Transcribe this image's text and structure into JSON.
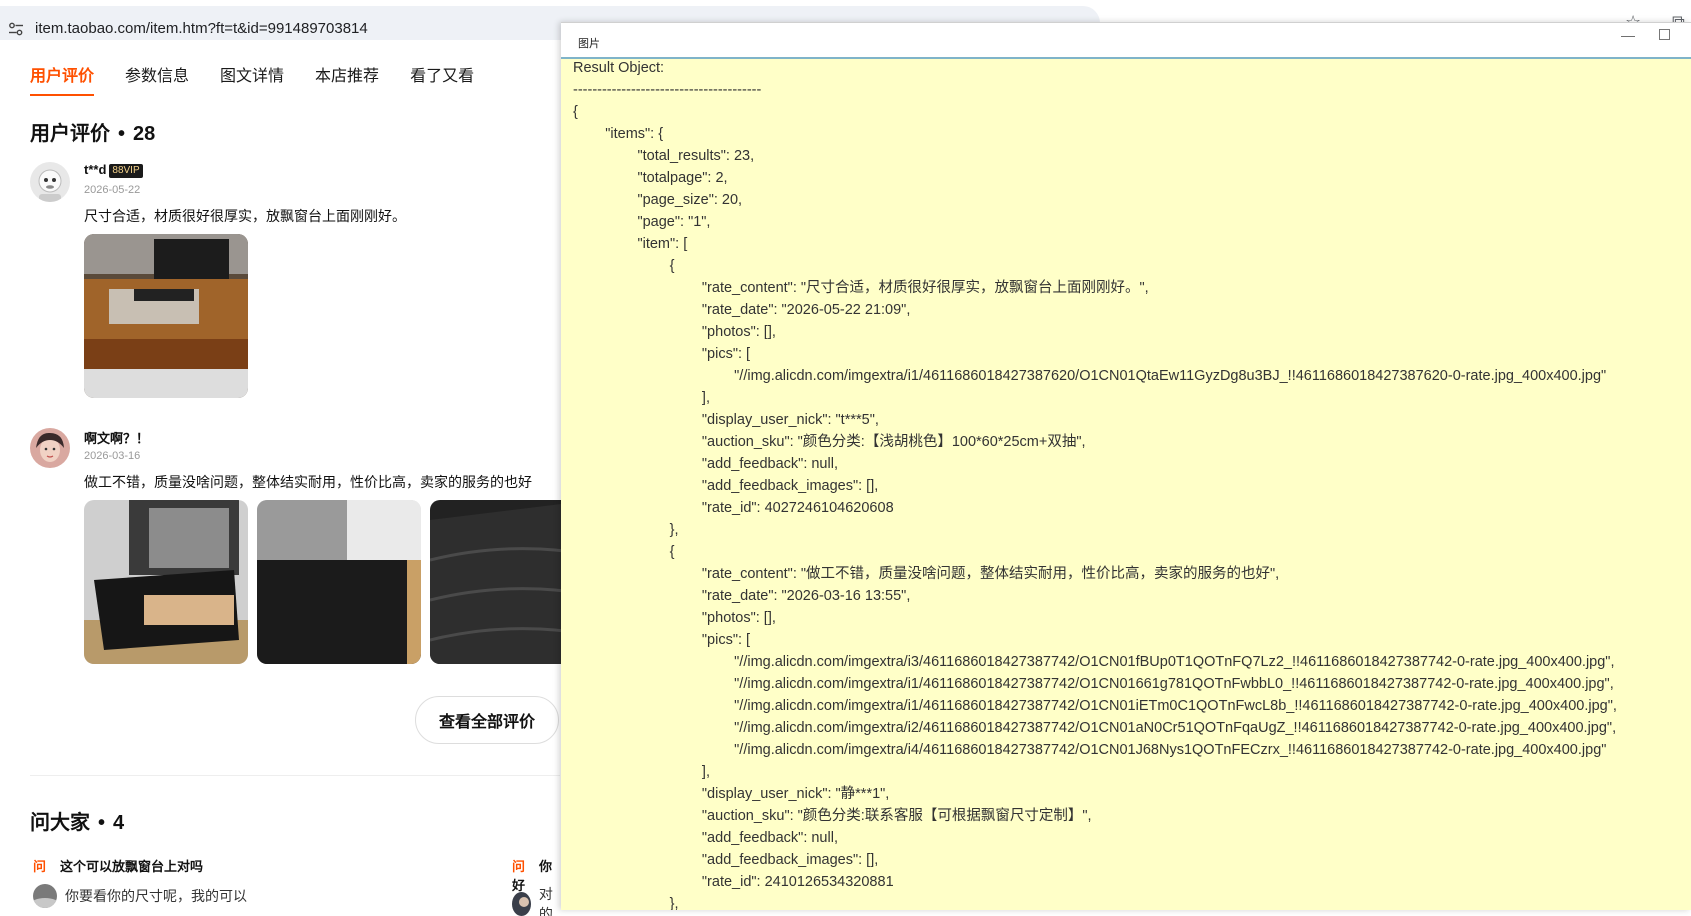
{
  "browser": {
    "url": "item.taobao.com/item.htm?ft=t&id=991489703814",
    "site_settings_icon": "tune-icon",
    "bookmark_icon": "star-icon",
    "extensions_icon": "puzzle-icon"
  },
  "tabs": [
    {
      "label": "用户评价",
      "active": true
    },
    {
      "label": "参数信息"
    },
    {
      "label": "图文详情"
    },
    {
      "label": "本店推荐"
    },
    {
      "label": "看了又看"
    }
  ],
  "reviews_section": {
    "title": "用户评价",
    "separator": "•",
    "count": "28",
    "reviews": [
      {
        "nick": "t**d",
        "vip_badge": "88VIP",
        "date": "2026-05-22",
        "content": "尺寸合适，材质很好很厚实，放飘窗台上面刚刚好。"
      },
      {
        "nick": "啊文啊？！",
        "date": "2026-03-16",
        "content": "做工不错，质量没啥问题，整体结实耐用，性价比高，卖家的服务的也好"
      }
    ],
    "view_all_label": "查看全部评价"
  },
  "qa_section": {
    "title": "问大家",
    "separator": "•",
    "count": "4",
    "items": [
      {
        "badge": "问",
        "question": "这个可以放飘窗台上对吗",
        "answer": "你要看你的尺寸呢，我的可以"
      },
      {
        "badge": "问",
        "question": "你好",
        "answer": "对的"
      }
    ]
  },
  "overlay": {
    "title": "图片",
    "accent_color": "#7fb4c9",
    "background_color": "#ffffc8",
    "lines": [
      "Result Object:",
      "---------------------------------------",
      "{",
      "        \"items\": {",
      "                \"total_results\": 23,",
      "                \"totalpage\": 2,",
      "                \"page_size\": 20,",
      "                \"page\": \"1\",",
      "                \"item\": [",
      "                        {",
      "                                \"rate_content\": \"尺寸合适，材质很好很厚实，放飘窗台上面刚刚好。\",",
      "                                \"rate_date\": \"2026-05-22 21:09\",",
      "                                \"photos\": [],",
      "                                \"pics\": [",
      "                                        \"//img.alicdn.com/imgextra/i1/4611686018427387620/O1CN01QtaEw11GyzDg8u3BJ_!!4611686018427387620-0-rate.jpg_400x400.jpg\"",
      "                                ],",
      "                                \"display_user_nick\": \"t***5\",",
      "                                \"auction_sku\": \"颜色分类:【浅胡桃色】100*60*25cm+双抽\",",
      "                                \"add_feedback\": null,",
      "                                \"add_feedback_images\": [],",
      "                                \"rate_id\": 4027246104620608",
      "                        },",
      "                        {",
      "                                \"rate_content\": \"做工不错，质量没啥问题，整体结实耐用，性价比高，卖家的服务的也好\",",
      "                                \"rate_date\": \"2026-03-16 13:55\",",
      "                                \"photos\": [],",
      "                                \"pics\": [",
      "                                        \"//img.alicdn.com/imgextra/i3/4611686018427387742/O1CN01fBUp0T1QOTnFQ7Lz2_!!4611686018427387742-0-rate.jpg_400x400.jpg\",",
      "                                        \"//img.alicdn.com/imgextra/i1/4611686018427387742/O1CN01661g781QOTnFwbbL0_!!4611686018427387742-0-rate.jpg_400x400.jpg\",",
      "                                        \"//img.alicdn.com/imgextra/i1/4611686018427387742/O1CN01iETm0C1QOTnFwcL8b_!!4611686018427387742-0-rate.jpg_400x400.jpg\",",
      "                                        \"//img.alicdn.com/imgextra/i2/4611686018427387742/O1CN01aN0Cr51QOTnFqaUgZ_!!4611686018427387742-0-rate.jpg_400x400.jpg\",",
      "                                        \"//img.alicdn.com/imgextra/i4/4611686018427387742/O1CN01J68Nys1QOTnFECzrx_!!4611686018427387742-0-rate.jpg_400x400.jpg\"",
      "                                ],",
      "                                \"display_user_nick\": \"静***1\",",
      "                                \"auction_sku\": \"颜色分类:联系客服【可根据飘窗尺寸定制】\",",
      "                                \"add_feedback\": null,",
      "                                \"add_feedback_images\": [],",
      "                                \"rate_id\": 2410126534320881",
      "                        },"
    ]
  }
}
